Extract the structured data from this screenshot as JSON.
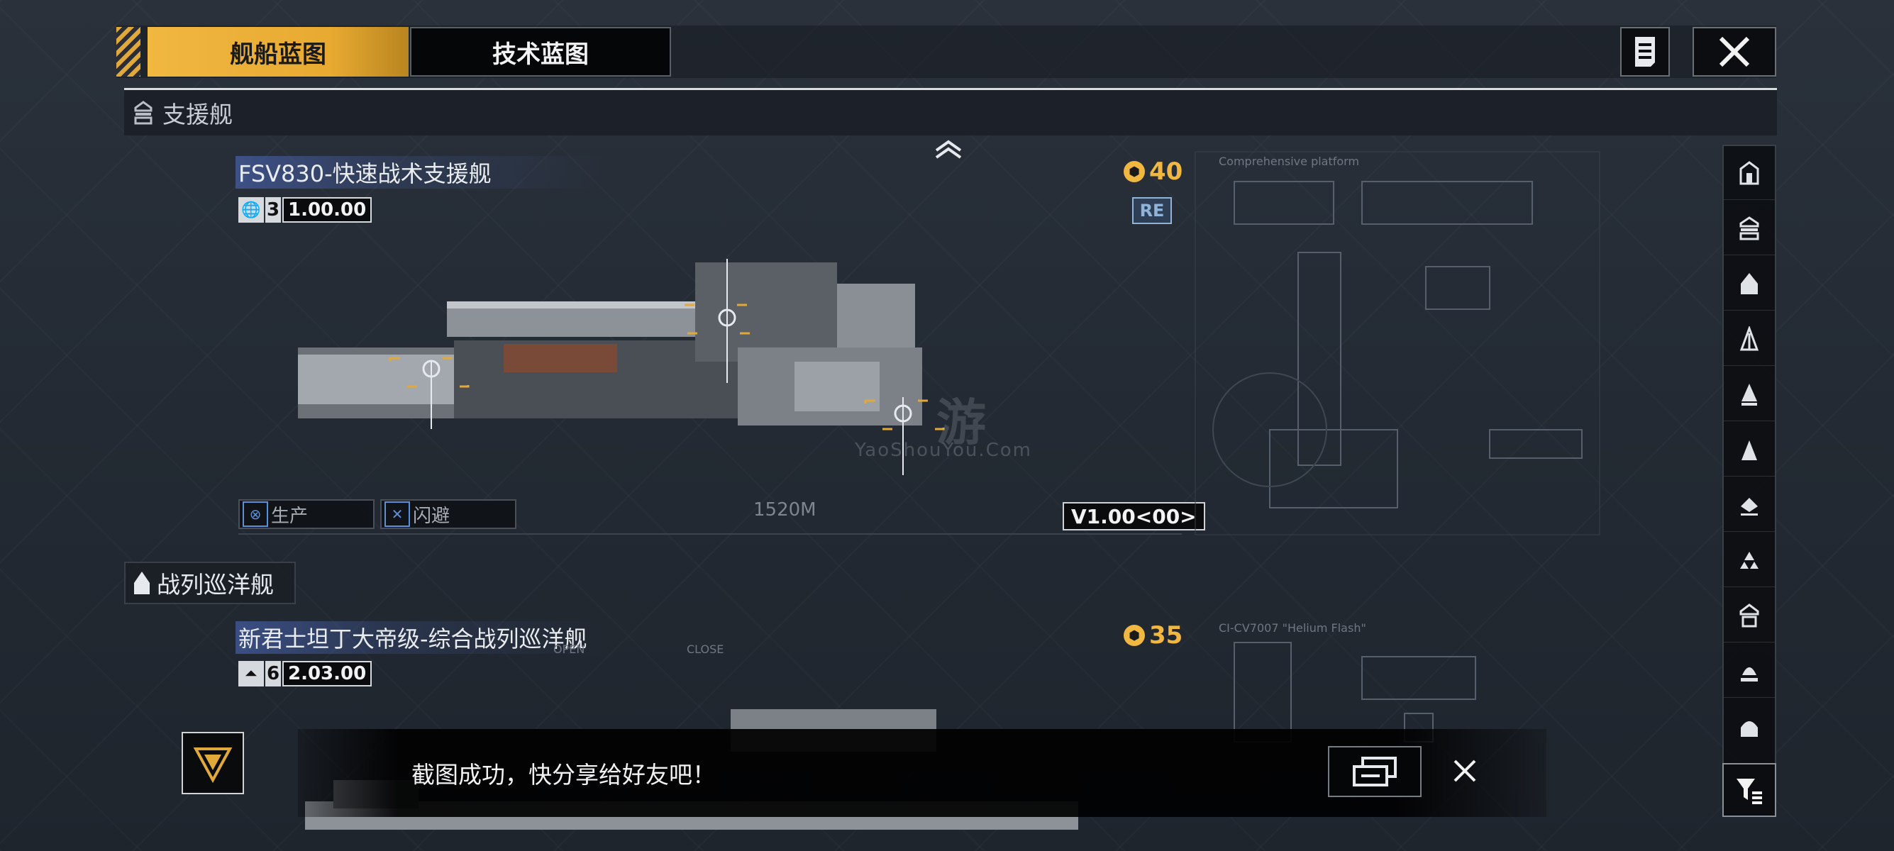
{
  "tabs": {
    "ship_blueprint": "舰船蓝图",
    "tech_blueprint": "技术蓝图"
  },
  "sections": {
    "support": "支援舰",
    "battlecruiser": "战列巡洋舰"
  },
  "ships": [
    {
      "name": "FSV830-快速战术支援舰",
      "level": "3",
      "version": "1.00.00",
      "cost": "40",
      "badge": "RE",
      "abilities": [
        "生产",
        "闪避"
      ],
      "version_tag": "V1.00<00>",
      "length_label": "1520M",
      "blueprint_title": "Comprehensive platform"
    },
    {
      "name": "新君士坦丁大帝级-综合战列巡洋舰",
      "level": "6",
      "version": "2.03.00",
      "cost": "35",
      "blueprint_title": "CI-CV7007 \"Helium Flash\"",
      "blueprint_labels": [
        "OPEN",
        "CLOSE"
      ]
    }
  ],
  "toast": {
    "message": "截图成功，快分享给好友吧！"
  },
  "watermark": "YaoShouYou.Com",
  "watermark_big": "游",
  "colors": {
    "accent": "#f0b741",
    "badge_blue": "#8fb3d9",
    "ability_blue": "#5d8fd6"
  }
}
